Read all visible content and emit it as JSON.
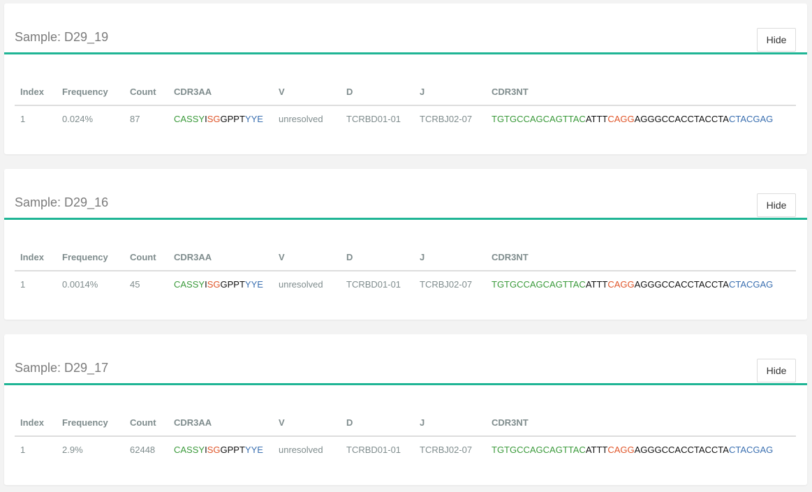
{
  "colors": {
    "accent_rule": "#1fb595",
    "v_segment": "#3a9a3a",
    "n_segment": "#e0562a",
    "d_segment": "#111111",
    "j_segment": "#3a6fb0"
  },
  "table_headers": {
    "index": "Index",
    "frequency": "Frequency",
    "count": "Count",
    "cdr3aa": "CDR3AA",
    "v": "V",
    "d": "D",
    "j": "J",
    "cdr3nt": "CDR3NT"
  },
  "hide_label": "Hide",
  "samples": [
    {
      "title": "Sample: D29_19",
      "row": {
        "index": "1",
        "frequency": "0.024%",
        "count": "87",
        "cdr3aa": [
          {
            "text": "CASSY",
            "part": "v"
          },
          {
            "text": "I",
            "part": "d"
          },
          {
            "text": "SG",
            "part": "n"
          },
          {
            "text": "GPPT",
            "part": "d"
          },
          {
            "text": "YYE",
            "part": "j"
          }
        ],
        "v": "unresolved",
        "d": "TCRBD01-01",
        "j": "TCRBJ02-07",
        "cdr3nt": [
          {
            "text": "TGTGCCAGCAGTTAC",
            "part": "v"
          },
          {
            "text": "ATTT",
            "part": "d"
          },
          {
            "text": "CAGG",
            "part": "n"
          },
          {
            "text": "AGGGCCACCTACCTA",
            "part": "d"
          },
          {
            "text": "CTACGAG",
            "part": "j"
          }
        ]
      }
    },
    {
      "title": "Sample: D29_16",
      "row": {
        "index": "1",
        "frequency": "0.0014%",
        "count": "45",
        "cdr3aa": [
          {
            "text": "CASSY",
            "part": "v"
          },
          {
            "text": "I",
            "part": "d"
          },
          {
            "text": "SG",
            "part": "n"
          },
          {
            "text": "GPPT",
            "part": "d"
          },
          {
            "text": "YYE",
            "part": "j"
          }
        ],
        "v": "unresolved",
        "d": "TCRBD01-01",
        "j": "TCRBJ02-07",
        "cdr3nt": [
          {
            "text": "TGTGCCAGCAGTTAC",
            "part": "v"
          },
          {
            "text": "ATTT",
            "part": "d"
          },
          {
            "text": "CAGG",
            "part": "n"
          },
          {
            "text": "AGGGCCACCTACCTA",
            "part": "d"
          },
          {
            "text": "CTACGAG",
            "part": "j"
          }
        ]
      }
    },
    {
      "title": "Sample: D29_17",
      "row": {
        "index": "1",
        "frequency": "2.9%",
        "count": "62448",
        "cdr3aa": [
          {
            "text": "CASSY",
            "part": "v"
          },
          {
            "text": "I",
            "part": "d"
          },
          {
            "text": "SG",
            "part": "n"
          },
          {
            "text": "GPPT",
            "part": "d"
          },
          {
            "text": "YYE",
            "part": "j"
          }
        ],
        "v": "unresolved",
        "d": "TCRBD01-01",
        "j": "TCRBJ02-07",
        "cdr3nt": [
          {
            "text": "TGTGCCAGCAGTTAC",
            "part": "v"
          },
          {
            "text": "ATTT",
            "part": "d"
          },
          {
            "text": "CAGG",
            "part": "n"
          },
          {
            "text": "AGGGCCACCTACCTA",
            "part": "d"
          },
          {
            "text": "CTACGAG",
            "part": "j"
          }
        ]
      }
    }
  ]
}
